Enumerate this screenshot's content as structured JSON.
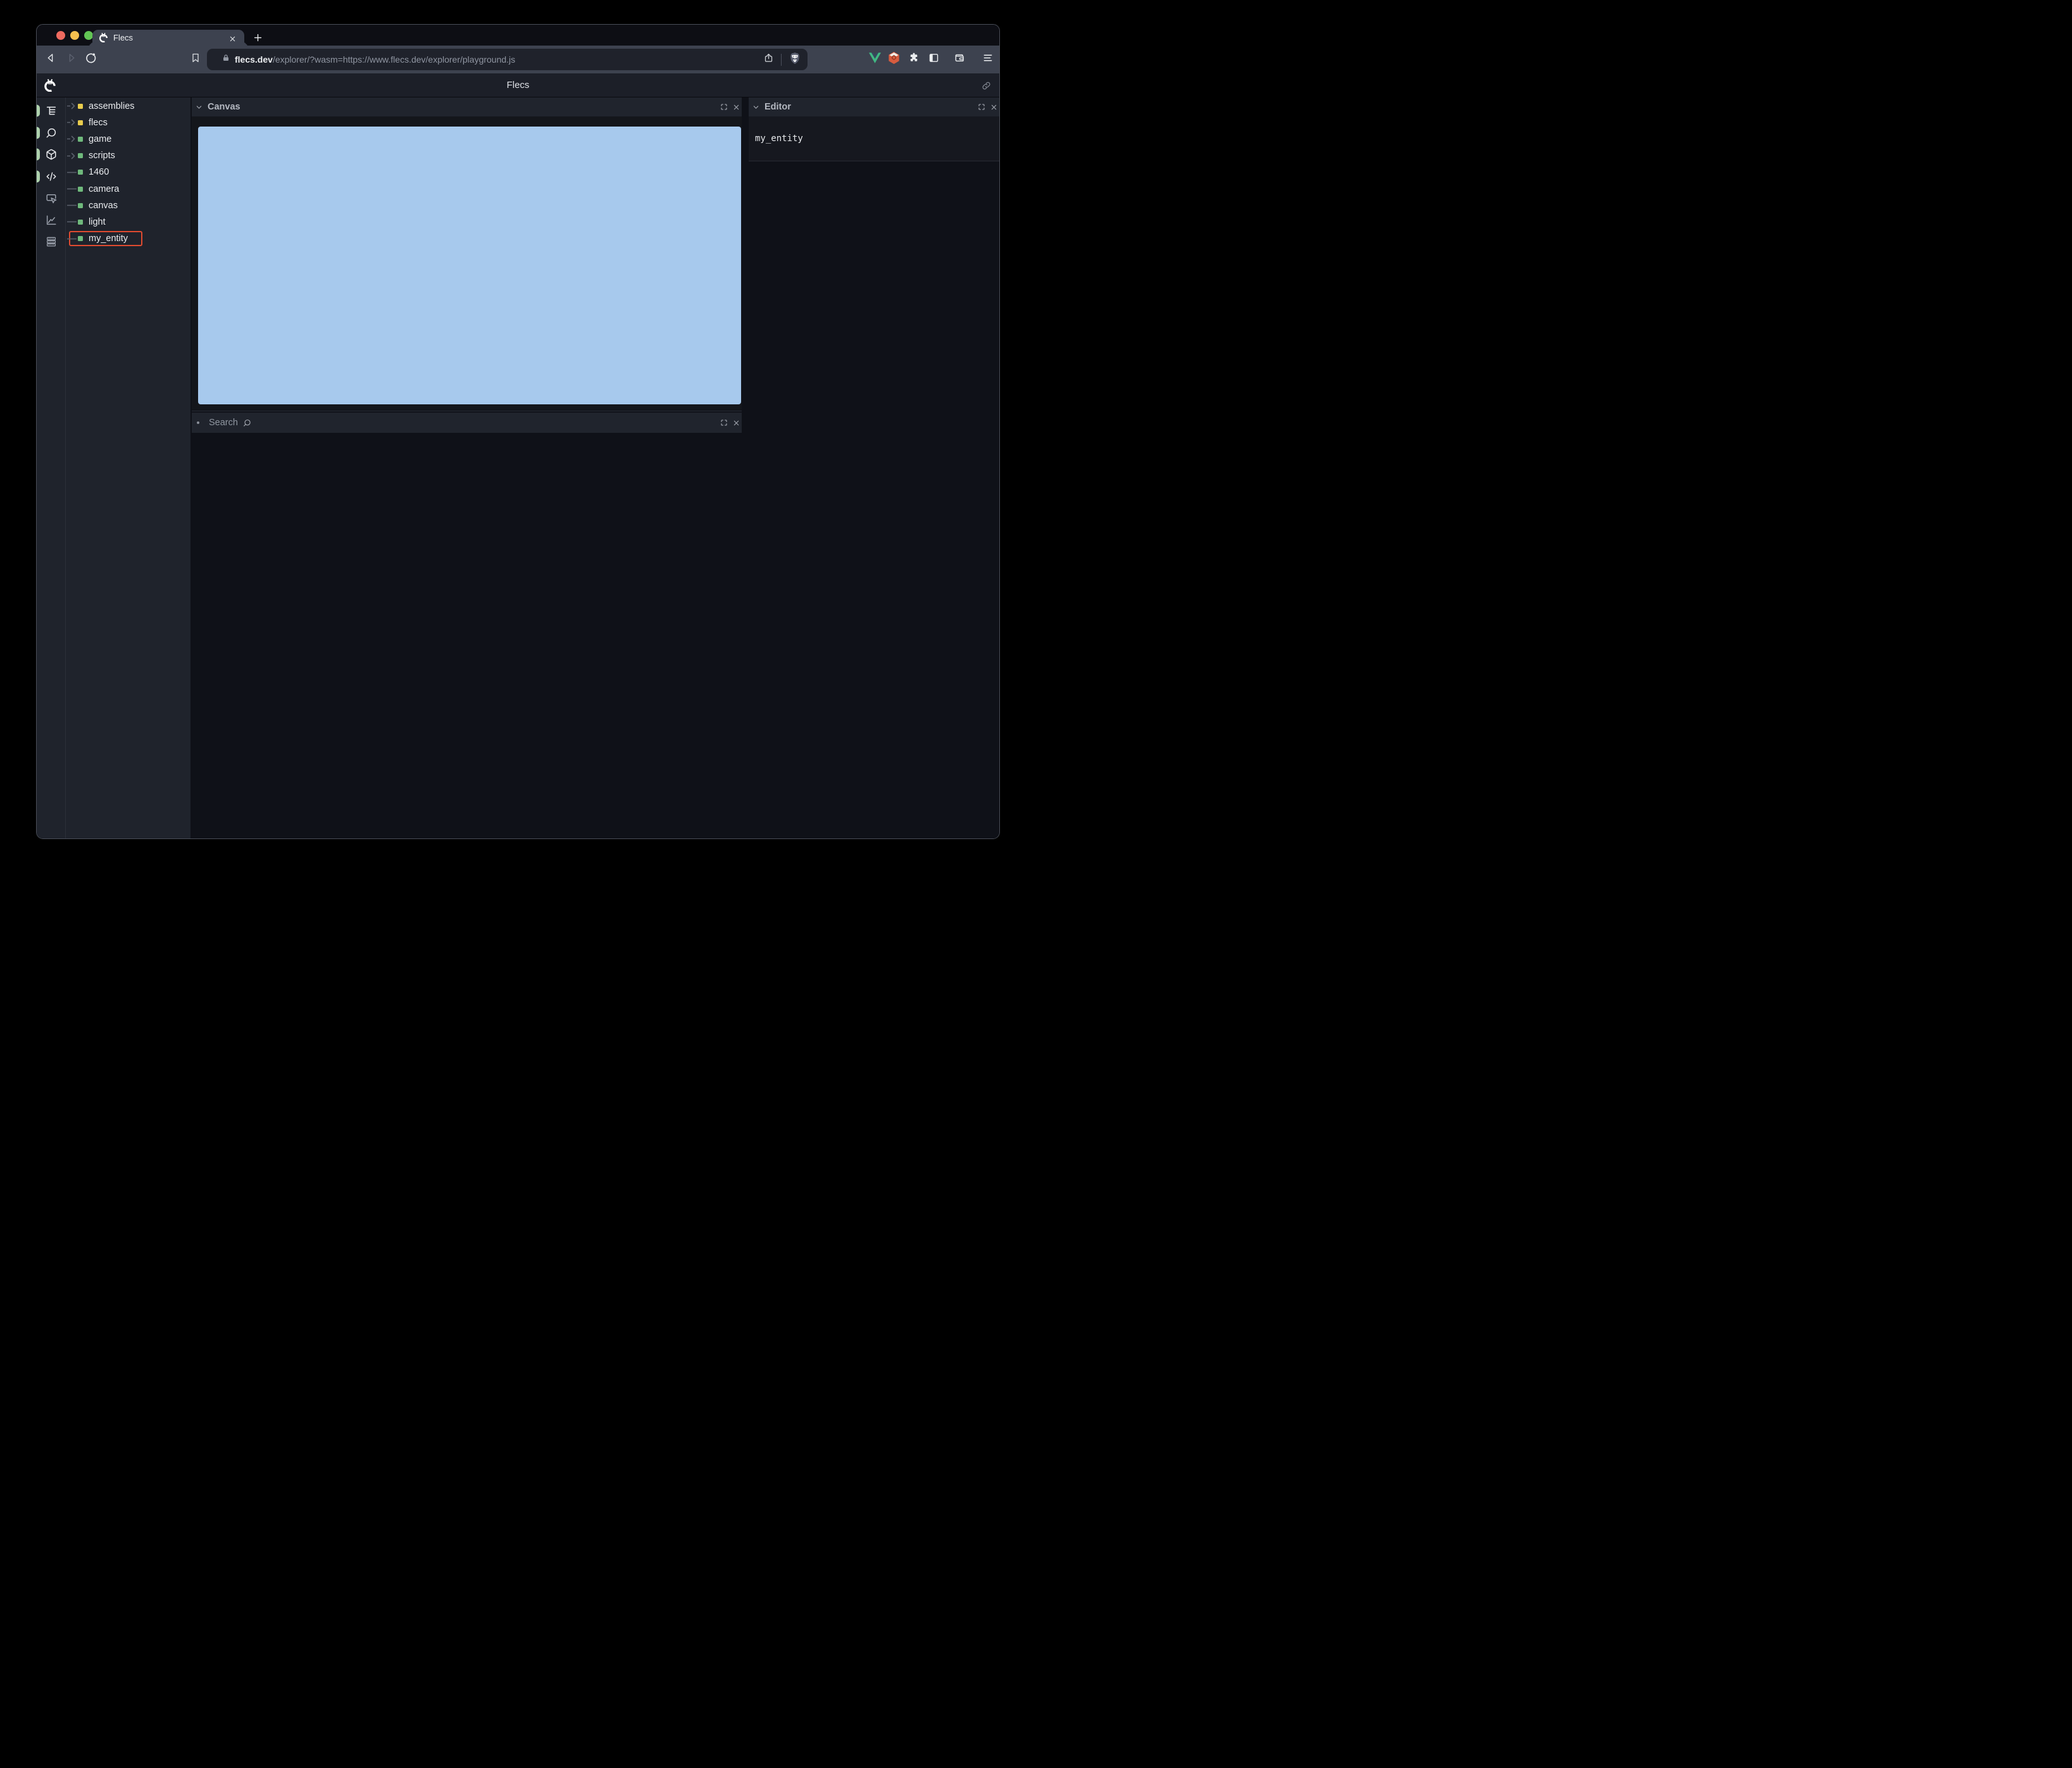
{
  "browser": {
    "tab": {
      "title": "Flecs",
      "favicon": "flecs-logo-icon",
      "close_icon": "close-icon",
      "new_tab_icon": "plus-icon"
    },
    "traffic_lights": {
      "close": "#ee6a5f",
      "minimize": "#f5bf4f",
      "maximize": "#62c554"
    },
    "toolbar": {
      "nav_icons": [
        "back-icon",
        "forward-icon",
        "reload-icon"
      ],
      "bookmark_icon": "bookmark-icon",
      "address": {
        "lock_icon": "lock-icon",
        "domain": "flecs.dev",
        "path": "/explorer/?wasm=https://www.flecs.dev/explorer/playground.js",
        "share_icon": "share-icon",
        "shield_icon": "brave-lion-icon"
      },
      "extensions": [
        "vue-devtools-icon",
        "hexagon-extension-icon",
        "puzzle-icon",
        "sidebar-toggle-icon",
        "wallet-icon"
      ],
      "menu_icon": "hamburger-menu-icon"
    }
  },
  "app": {
    "title": "Flecs",
    "logo": "flecs-logo-icon",
    "link_icon": "link-icon",
    "sidebar": {
      "items": [
        {
          "name": "tree",
          "icon": "tree-icon",
          "active": true
        },
        {
          "name": "search",
          "icon": "search-icon",
          "active": true
        },
        {
          "name": "entities",
          "icon": "cube-icon",
          "active": true
        },
        {
          "name": "editor",
          "icon": "code-icon",
          "active": true
        },
        {
          "name": "canvas",
          "icon": "screen-pointer-icon",
          "active": false
        },
        {
          "name": "statistics",
          "icon": "chart-line-icon",
          "active": false
        },
        {
          "name": "tables",
          "icon": "table-rows-icon",
          "active": false
        }
      ]
    },
    "tree": {
      "items": [
        {
          "label": "assemblies",
          "color": "yellow",
          "expandable": true,
          "selected": false
        },
        {
          "label": "flecs",
          "color": "yellow",
          "expandable": true,
          "selected": false
        },
        {
          "label": "game",
          "color": "green",
          "expandable": true,
          "selected": false
        },
        {
          "label": "scripts",
          "color": "green",
          "expandable": true,
          "selected": false
        },
        {
          "label": "1460",
          "color": "green",
          "expandable": false,
          "selected": false
        },
        {
          "label": "camera",
          "color": "green",
          "expandable": false,
          "selected": false
        },
        {
          "label": "canvas",
          "color": "green",
          "expandable": false,
          "selected": false
        },
        {
          "label": "light",
          "color": "green",
          "expandable": false,
          "selected": false
        },
        {
          "label": "my_entity",
          "color": "green",
          "expandable": false,
          "selected": true
        }
      ],
      "selection_color": "#e04b30"
    },
    "panels": {
      "canvas": {
        "title": "Canvas",
        "collapse_icon": "chevron-down-icon",
        "fullscreen_icon": "fullscreen-icon",
        "close_icon": "close-icon",
        "canvas_color": "#a7c9ed"
      },
      "search": {
        "title": "Search",
        "bullet_icon": "dot-icon",
        "search_icon": "magnifier-icon",
        "fullscreen_icon": "fullscreen-icon",
        "close_icon": "close-icon"
      },
      "editor": {
        "title": "Editor",
        "collapse_icon": "chevron-down-icon",
        "fullscreen_icon": "fullscreen-icon",
        "close_icon": "close-icon",
        "entity": "my_entity"
      }
    }
  }
}
